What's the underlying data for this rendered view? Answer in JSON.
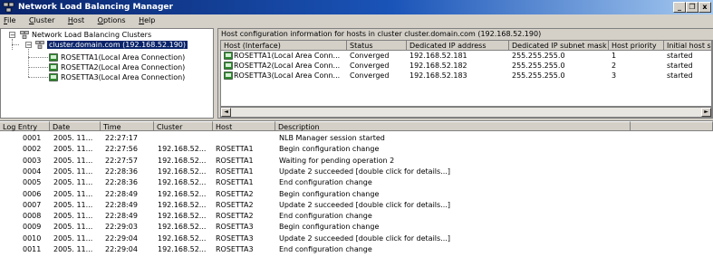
{
  "window": {
    "title": "Network Load Balancing Manager",
    "title_bar_color": "#0a246a",
    "controls": {
      "minimize": "_",
      "restore": "❐",
      "close": "x"
    }
  },
  "menu": [
    {
      "label": "File",
      "key": "F",
      "rest": "ile"
    },
    {
      "label": "Cluster",
      "key": "C",
      "rest": "luster"
    },
    {
      "label": "Host",
      "key": "H",
      "rest": "ost"
    },
    {
      "label": "Options",
      "key": "O",
      "rest": "ptions"
    },
    {
      "label": "Help",
      "key": "H",
      "rest": "elp"
    }
  ],
  "tree": {
    "root": "Network Load Balancing Clusters",
    "cluster": "cluster.domain.com (192.168.52.190)",
    "hosts": [
      "ROSETTA1(Local Area Connection)",
      "ROSETTA2(Local Area Connection)",
      "ROSETTA3(Local Area Connection)"
    ],
    "expander_symbol": "−",
    "selection_color": "#0a246a"
  },
  "host_config": {
    "caption": "Host configuration information for hosts in cluster cluster.domain.com (192.168.52.190)",
    "columns": [
      "Host (Interface)",
      "Status",
      "Dedicated IP address",
      "Dedicated IP subnet mask",
      "Host priority",
      "Initial host state"
    ],
    "rows": [
      [
        "ROSETTA1(Local Area Conn...",
        "Converged",
        "192.168.52.181",
        "255.255.255.0",
        "1",
        "started"
      ],
      [
        "ROSETTA2(Local Area Conn...",
        "Converged",
        "192.168.52.182",
        "255.255.255.0",
        "2",
        "started"
      ],
      [
        "ROSETTA3(Local Area Conn...",
        "Converged",
        "192.168.52.183",
        "255.255.255.0",
        "3",
        "started"
      ]
    ],
    "scroll_left": "◄",
    "scroll_right": "►",
    "converged_icon_color": "#2e8b2e"
  },
  "log": {
    "columns": [
      "Log Entry",
      "Date",
      "Time",
      "Cluster",
      "Host",
      "Description"
    ],
    "rows": [
      [
        "0001",
        "2005. 11...",
        "22:27:17",
        "",
        "",
        "NLB Manager session started"
      ],
      [
        "0002",
        "2005. 11...",
        "22:27:56",
        "192.168.52...",
        "ROSETTA1",
        "Begin configuration change"
      ],
      [
        "0003",
        "2005. 11...",
        "22:27:57",
        "192.168.52...",
        "ROSETTA1",
        "Waiting for pending operation 2"
      ],
      [
        "0004",
        "2005. 11...",
        "22:28:36",
        "192.168.52...",
        "ROSETTA1",
        "Update 2 succeeded [double click for details...]"
      ],
      [
        "0005",
        "2005. 11...",
        "22:28:36",
        "192.168.52...",
        "ROSETTA1",
        "End configuration change"
      ],
      [
        "0006",
        "2005. 11...",
        "22:28:49",
        "192.168.52...",
        "ROSETTA2",
        "Begin configuration change"
      ],
      [
        "0007",
        "2005. 11...",
        "22:28:49",
        "192.168.52...",
        "ROSETTA2",
        "Update 2 succeeded [double click for details...]"
      ],
      [
        "0008",
        "2005. 11...",
        "22:28:49",
        "192.168.52...",
        "ROSETTA2",
        "End configuration change"
      ],
      [
        "0009",
        "2005. 11...",
        "22:29:03",
        "192.168.52...",
        "ROSETTA3",
        "Begin configuration change"
      ],
      [
        "0010",
        "2005. 11...",
        "22:29:04",
        "192.168.52...",
        "ROSETTA3",
        "Update 2 succeeded [double click for details...]"
      ],
      [
        "0011",
        "2005. 11...",
        "22:29:04",
        "192.168.52...",
        "ROSETTA3",
        "End configuration change"
      ]
    ]
  }
}
